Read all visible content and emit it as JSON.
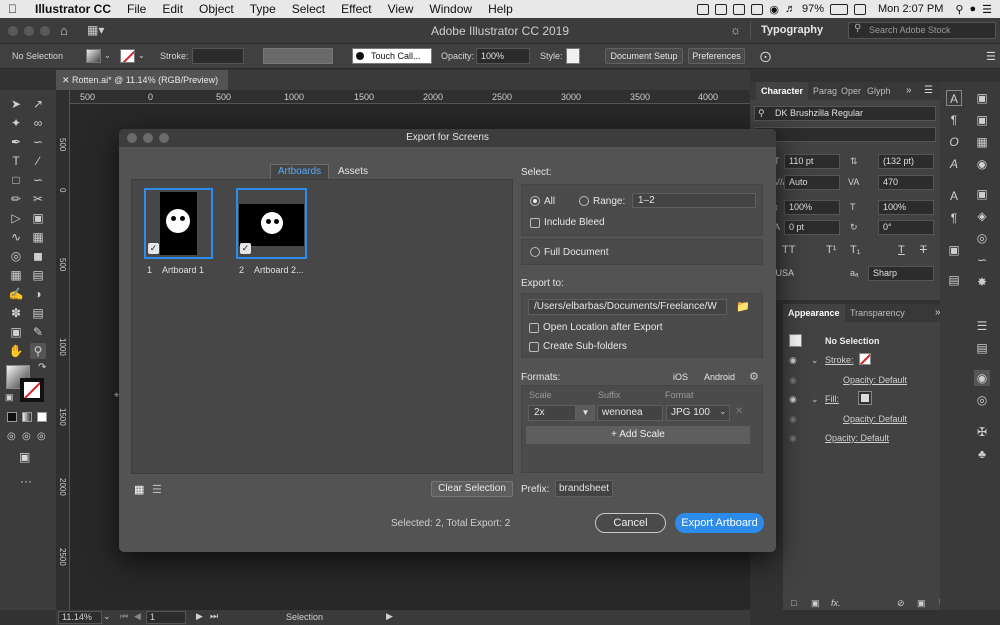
{
  "menubar": {
    "app_name": "Illustrator CC",
    "menus": [
      "File",
      "Edit",
      "Object",
      "Type",
      "Select",
      "Effect",
      "View",
      "Window",
      "Help"
    ],
    "battery": "97%",
    "clock": "Mon 2:07 PM"
  },
  "appbar": {
    "title": "Adobe Illustrator CC 2019",
    "workspace": "Typography",
    "search_placeholder": "Search Adobe Stock"
  },
  "control_bar": {
    "selection": "No Selection",
    "stroke_label": "Stroke:",
    "brush": "Touch Call...",
    "opacity_label": "Opacity:",
    "opacity_value": "100%",
    "style_label": "Style:",
    "document_setup": "Document Setup",
    "preferences": "Preferences"
  },
  "document_tab": "Rotten.ai* @ 11.14% (RGB/Preview)",
  "ruler": {
    "h_ticks": [
      "500",
      "0",
      "500",
      "1000",
      "1500",
      "2000",
      "2500",
      "3000",
      "3500",
      "4000"
    ],
    "v_ticks": [
      "500",
      "0",
      "500",
      "1000",
      "1500",
      "2000",
      "2500"
    ]
  },
  "status_bar": {
    "zoom": "11.14%",
    "page": "1",
    "mode": "Selection"
  },
  "character_panel": {
    "tabs": [
      "Character",
      "Parag",
      "Oper",
      "Glyph"
    ],
    "font": "DK Brushzilla Regular",
    "style": "ular",
    "size": "110 pt",
    "leading": "(132 pt)",
    "kerning": "Auto",
    "tracking": "470",
    "vscale": "100%",
    "hscale": "100%",
    "baseline": "0 pt",
    "rotation": "0°",
    "language": "ish: USA",
    "aa": "Sharp"
  },
  "appearance_panel": {
    "tabs": [
      "Appearance",
      "Transparency"
    ],
    "header": "No Selection",
    "rows": [
      {
        "label": "Stroke:",
        "indent": 1
      },
      {
        "label": "Opacity: Default",
        "indent": 2
      },
      {
        "label": "Fill:",
        "indent": 1
      },
      {
        "label": "Opacity: Default",
        "indent": 2
      },
      {
        "label": "Opacity: Default",
        "indent": 1
      }
    ]
  },
  "dialog": {
    "title": "Export for Screens",
    "tabs": [
      "Artboards",
      "Assets"
    ],
    "artboards": [
      {
        "num": "1",
        "name": "Artboard 1"
      },
      {
        "num": "2",
        "name": "Artboard 2..."
      }
    ],
    "clear_selection": "Clear Selection",
    "prefix_label": "Prefix:",
    "prefix_value": "brandsheet",
    "select_label": "Select:",
    "all_label": "All",
    "range_label": "Range:",
    "range_value": "1–2",
    "include_bleed": "Include Bleed",
    "full_document": "Full Document",
    "export_to_label": "Export to:",
    "export_path": "/Users/elbarbas/Documents/Freelance/W",
    "open_location": "Open Location after Export",
    "create_subfolders": "Create Sub-folders",
    "formats_label": "Formats:",
    "ios": "iOS",
    "android": "Android",
    "col_scale": "Scale",
    "col_suffix": "Suffix",
    "col_format": "Format",
    "scale_value": "2x",
    "suffix_value": "wenonea",
    "format_value": "JPG 100",
    "add_scale": "+ Add Scale",
    "summary": "Selected: 2, Total Export: 2",
    "cancel": "Cancel",
    "export": "Export Artboard"
  },
  "colors": {
    "accent": "#2d8ceb",
    "dialog_bg": "#535353",
    "app_bg": "#323232"
  }
}
